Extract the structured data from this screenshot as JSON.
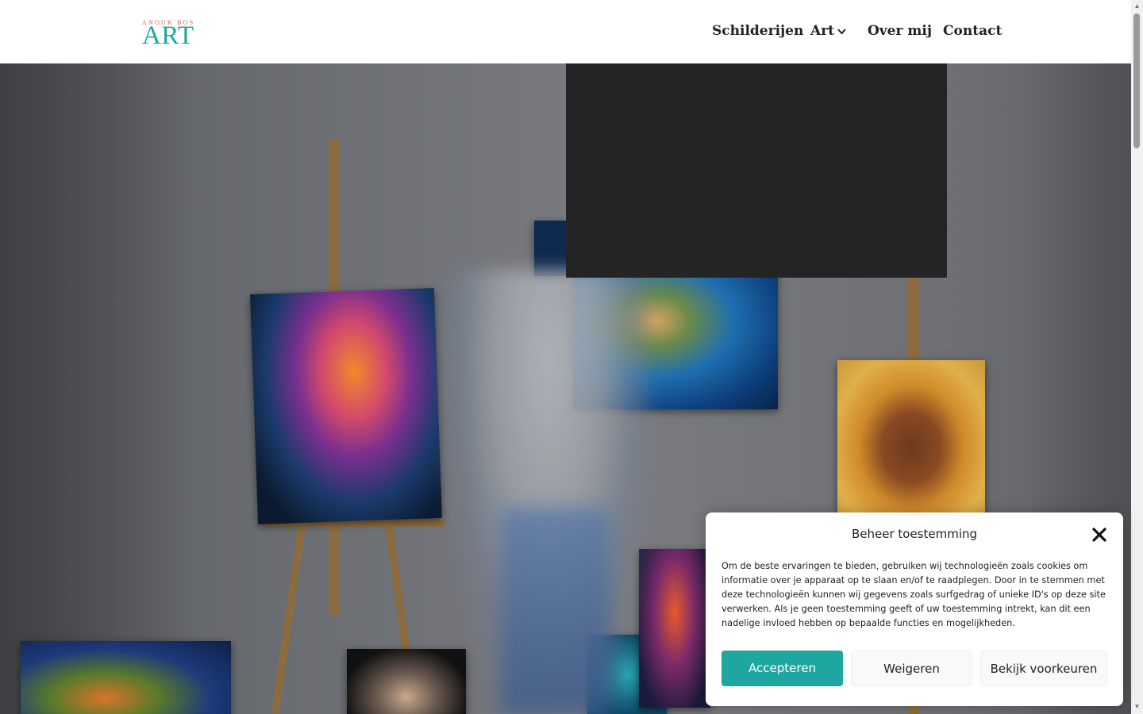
{
  "logo": {
    "small": "ANOUK BOS",
    "big": "ART"
  },
  "nav": {
    "items": [
      {
        "label": "Schilderijen"
      },
      {
        "label": "Art"
      },
      {
        "label": "Over mij"
      },
      {
        "label": "Contact"
      }
    ]
  },
  "cookie": {
    "title": "Beheer toestemming",
    "text": "Om de beste ervaringen te bieden, gebruiken wij technologieën zoals cookies om informatie over je apparaat op te slaan en/of te raadplegen. Door in te stemmen met deze technologieën kunnen wij gegevens zoals surfgedrag of unieke ID's op deze site verwerken. Als je geen toestemming geeft of uw toestemming intrekt, kan dit een nadelige invloed hebben op bepaalde functies en mogelijkheden.",
    "accept": "Accepteren",
    "deny": "Weigeren",
    "prefs": "Bekijk voorkeuren"
  },
  "colors": {
    "accent": "#1ea7a0",
    "logo_small": "#d9603a",
    "dark_box": "#242424"
  },
  "icons": {
    "close": "close-icon",
    "chevron": "chevron-down-icon"
  }
}
